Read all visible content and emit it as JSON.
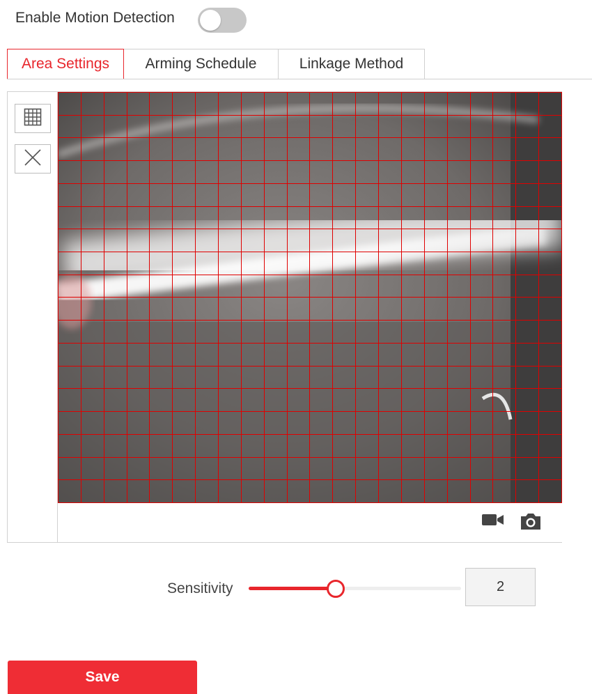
{
  "motion_detection": {
    "label": "Enable Motion Detection",
    "enabled": false
  },
  "tabs": [
    {
      "label": "Area Settings",
      "active": true
    },
    {
      "label": "Arming Schedule",
      "active": false
    },
    {
      "label": "Linkage Method",
      "active": false
    }
  ],
  "area_editor": {
    "tools": [
      "draw-grid-icon",
      "clear-x-icon"
    ],
    "grid": {
      "columns": 22,
      "rows": 18,
      "color": "#e00000"
    },
    "video_controls": [
      "video-camera-icon",
      "snapshot-camera-icon"
    ]
  },
  "sensitivity": {
    "label": "Sensitivity",
    "value": "2",
    "level_fraction": 0.41
  },
  "save_label": "Save",
  "colors": {
    "accent": "#e8262c",
    "save_button": "#ef2d35",
    "toggle_off": "#c8c8c8"
  }
}
